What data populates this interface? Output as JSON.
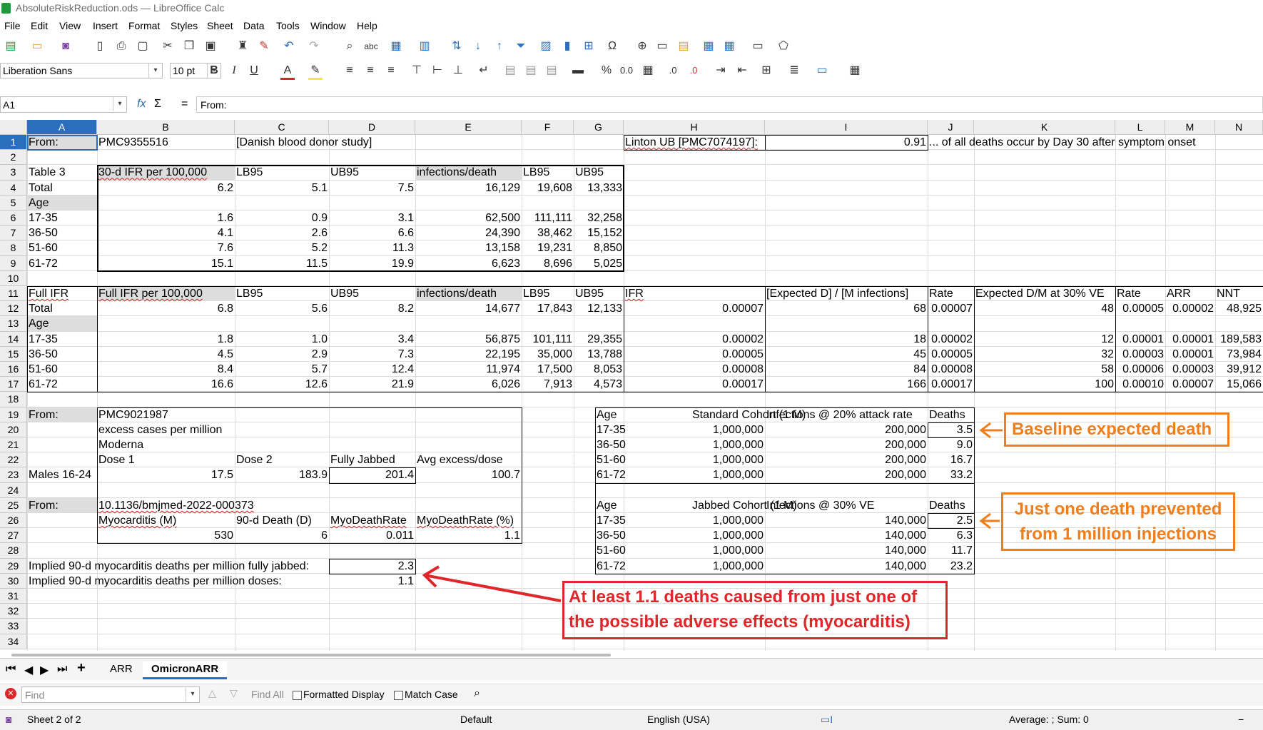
{
  "window": {
    "title": "AbsoluteRiskReduction.ods — LibreOffice Calc"
  },
  "menu": [
    "File",
    "Edit",
    "View",
    "Insert",
    "Format",
    "Styles",
    "Sheet",
    "Data",
    "Tools",
    "Window",
    "Help"
  ],
  "format_toolbar": {
    "font_name": "Liberation Sans",
    "font_size": "10 pt"
  },
  "formula_bar": {
    "cell_ref": "A1",
    "fx": "fx",
    "sigma": "Σ",
    "equals": "=",
    "content": "From:"
  },
  "columns": [
    "A",
    "B",
    "C",
    "D",
    "E",
    "F",
    "G",
    "H",
    "I",
    "J",
    "K",
    "L",
    "M",
    "N"
  ],
  "rows": [
    "1",
    "2",
    "3",
    "4",
    "5",
    "6",
    "7",
    "8",
    "9",
    "10",
    "11",
    "12",
    "13",
    "14",
    "15",
    "16",
    "17",
    "18",
    "19",
    "20",
    "21",
    "22",
    "23",
    "24",
    "25",
    "26",
    "27",
    "28",
    "29",
    "30",
    "31",
    "32",
    "33",
    "34"
  ],
  "cells": {
    "r1": {
      "A": "From:",
      "B": "PMC9355516",
      "C": "[Danish blood donor study]",
      "H": "Linton UB [PMC7074197]:",
      "I": "0.91",
      "J": "... of all deaths occur by Day 30 after symptom onset"
    },
    "r3": {
      "A": "Table 3",
      "B": "30-d IFR per 100,000",
      "C": "LB95",
      "D": "UB95",
      "E": "infections/death",
      "F": "LB95",
      "G": "UB95"
    },
    "r4": {
      "A": "Total",
      "B": "6.2",
      "C": "5.1",
      "D": "7.5",
      "E": "16,129",
      "F": "19,608",
      "G": "13,333"
    },
    "r5": {
      "A": "Age"
    },
    "r6": {
      "A": "17-35",
      "B": "1.6",
      "C": "0.9",
      "D": "3.1",
      "E": "62,500",
      "F": "111,111",
      "G": "32,258"
    },
    "r7": {
      "A": "36-50",
      "B": "4.1",
      "C": "2.6",
      "D": "6.6",
      "E": "24,390",
      "F": "38,462",
      "G": "15,152"
    },
    "r8": {
      "A": "51-60",
      "B": "7.6",
      "C": "5.2",
      "D": "11.3",
      "E": "13,158",
      "F": "19,231",
      "G": "8,850"
    },
    "r9": {
      "A": "61-72",
      "B": "15.1",
      "C": "11.5",
      "D": "19.9",
      "E": "6,623",
      "F": "8,696",
      "G": "5,025"
    },
    "r11": {
      "A": "Full IFR",
      "B": "Full IFR per 100,000",
      "C": "LB95",
      "D": "UB95",
      "E": "infections/death",
      "F": "LB95",
      "G": "UB95",
      "H": "IFR",
      "I": "[Expected D] / [M infections]",
      "J": "Rate",
      "K": "Expected D/M at 30% VE",
      "L": "Rate",
      "M": "ARR",
      "N": "NNT"
    },
    "r12": {
      "A": "Total",
      "B": "6.8",
      "C": "5.6",
      "D": "8.2",
      "E": "14,677",
      "F": "17,843",
      "G": "12,133",
      "H": "0.00007",
      "I": "68",
      "J": "0.00007",
      "K": "48",
      "L": "0.00005",
      "M": "0.00002",
      "N": "48,925"
    },
    "r13": {
      "A": "Age"
    },
    "r14": {
      "A": "17-35",
      "B": "1.8",
      "C": "1.0",
      "D": "3.4",
      "E": "56,875",
      "F": "101,111",
      "G": "29,355",
      "H": "0.00002",
      "I": "18",
      "J": "0.00002",
      "K": "12",
      "L": "0.00001",
      "M": "0.00001",
      "N": "189,583"
    },
    "r15": {
      "A": "36-50",
      "B": "4.5",
      "C": "2.9",
      "D": "7.3",
      "E": "22,195",
      "F": "35,000",
      "G": "13,788",
      "H": "0.00005",
      "I": "45",
      "J": "0.00005",
      "K": "32",
      "L": "0.00003",
      "M": "0.00001",
      "N": "73,984"
    },
    "r16": {
      "A": "51-60",
      "B": "8.4",
      "C": "5.7",
      "D": "12.4",
      "E": "11,974",
      "F": "17,500",
      "G": "8,053",
      "H": "0.00008",
      "I": "84",
      "J": "0.00008",
      "K": "58",
      "L": "0.00006",
      "M": "0.00003",
      "N": "39,912"
    },
    "r17": {
      "A": "61-72",
      "B": "16.6",
      "C": "12.6",
      "D": "21.9",
      "E": "6,026",
      "F": "7,913",
      "G": "4,573",
      "H": "0.00017",
      "I": "166",
      "J": "0.00017",
      "K": "100",
      "L": "0.00010",
      "M": "0.00007",
      "N": "15,066"
    },
    "r19": {
      "A": "From:",
      "B": "PMC9021987",
      "H": "Age",
      "I": "Standard Cohort (1 M)",
      "I2": "Infections @ 20% attack rate",
      "J": "Deaths"
    },
    "r20": {
      "B": "excess cases per million",
      "H": "17-35",
      "I": "1,000,000",
      "I2": "200,000",
      "J": "3.5"
    },
    "r21": {
      "B": "Moderna",
      "H": "36-50",
      "I": "1,000,000",
      "I2": "200,000",
      "J": "9.0"
    },
    "r22": {
      "B": "Dose 1",
      "C": "Dose 2",
      "D": "Fully Jabbed",
      "E": "Avg excess/dose",
      "H": "51-60",
      "I": "1,000,000",
      "I2": "200,000",
      "J": "16.7"
    },
    "r23": {
      "A": "Males 16-24",
      "B": "17.5",
      "C": "183.9",
      "D": "201.4",
      "E": "100.7",
      "H": "61-72",
      "I": "1,000,000",
      "I2": "200,000",
      "J": "33.2"
    },
    "r25": {
      "A": "From:",
      "B": "10.1136/bmjmed-2022-000373",
      "H": "Age",
      "I": "Jabbed Cohort (1 M)",
      "I2": "Infections @ 30% VE",
      "J": "Deaths"
    },
    "r26": {
      "B": "Myocarditis (M)",
      "C": "90-d Death (D)",
      "D": "MyoDeathRate",
      "E": "MyoDeathRate (%)",
      "H": "17-35",
      "I": "1,000,000",
      "I2": "140,000",
      "J": "2.5"
    },
    "r27": {
      "B": "530",
      "C": "6",
      "D": "0.011",
      "E": "1.1",
      "H": "36-50",
      "I": "1,000,000",
      "I2": "140,000",
      "J": "6.3"
    },
    "r28": {
      "H": "51-60",
      "I": "1,000,000",
      "I2": "140,000",
      "J": "11.7"
    },
    "r29": {
      "A": "Implied 90-d myocarditis deaths per million fully jabbed:",
      "D": "2.3",
      "H": "61-72",
      "I": "1,000,000",
      "I2": "140,000",
      "J": "23.2"
    },
    "r30": {
      "A": "Implied 90-d myocarditis deaths per million doses:",
      "D": "1.1"
    }
  },
  "annotations": {
    "baseline": "Baseline expected death",
    "prevented_1": "Just one death prevented",
    "prevented_2": "from 1 million injections",
    "caused_1": "At least 1.1 deaths caused from just one of",
    "caused_2": "the possible adverse effects (myocarditis)",
    "colors": {
      "orange": "#f07e1c",
      "red": "#e0262a"
    }
  },
  "sheet_tabs": [
    "ARR",
    "OmicronARR"
  ],
  "active_tab": "OmicronARR",
  "find_bar": {
    "placeholder": "Find",
    "find_all": "Find All",
    "formatted_display": "Formatted Display",
    "match_case": "Match Case"
  },
  "status_bar": {
    "sheet": "Sheet 2 of 2",
    "style": "Default",
    "language": "English (USA)",
    "summary": "Average: ; Sum: 0"
  }
}
